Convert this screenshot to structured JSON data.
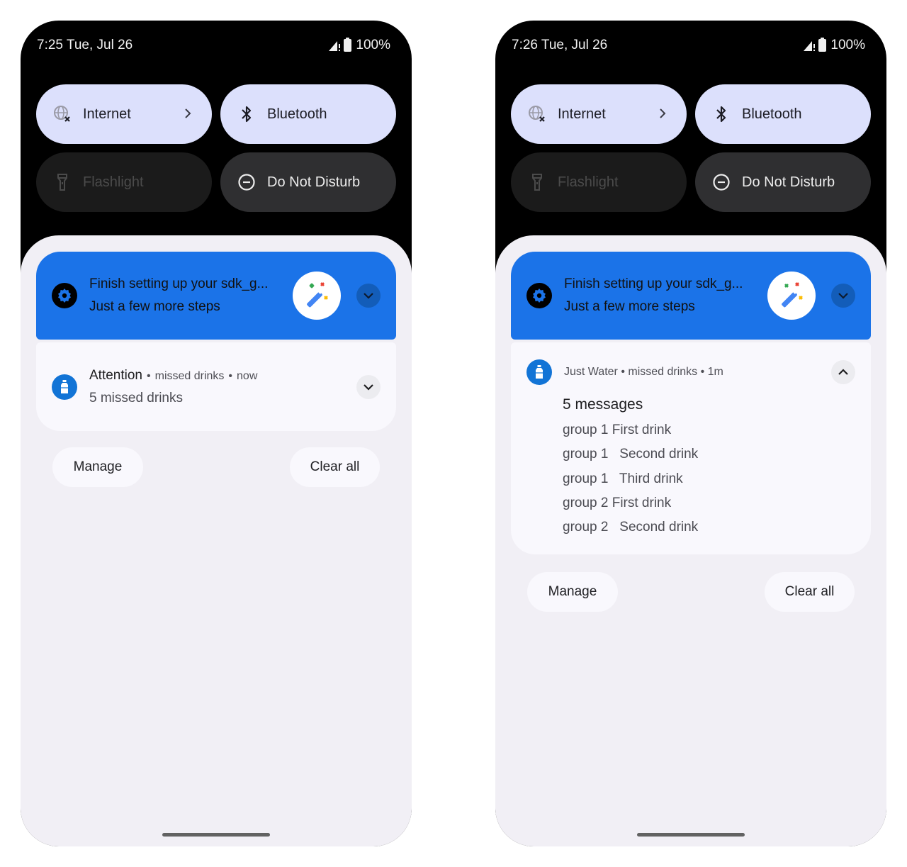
{
  "phones": [
    {
      "status": {
        "time_date": "7:25 Tue, Jul 26",
        "battery": "100%"
      },
      "tiles": [
        {
          "label": "Internet",
          "icon": "globe-no-connection-icon",
          "state": "on",
          "has_chevron": true
        },
        {
          "label": "Bluetooth",
          "icon": "bluetooth-icon",
          "state": "on"
        },
        {
          "label": "Flashlight",
          "icon": "flashlight-icon",
          "state": "unavailable"
        },
        {
          "label": "Do Not Disturb",
          "icon": "do-not-disturb-icon",
          "state": "off"
        }
      ],
      "setup_notification": {
        "title": "Finish setting up your sdk_g...",
        "subtitle": "Just a few more steps"
      },
      "drinks_notification": {
        "expanded": false,
        "app_title": "Attention",
        "channel": "missed drinks",
        "time": "now",
        "body": "5 missed drinks"
      },
      "actions": {
        "manage": "Manage",
        "clear_all": "Clear all"
      }
    },
    {
      "status": {
        "time_date": "7:26 Tue, Jul 26",
        "battery": "100%"
      },
      "tiles": [
        {
          "label": "Internet",
          "icon": "globe-no-connection-icon",
          "state": "on",
          "has_chevron": true
        },
        {
          "label": "Bluetooth",
          "icon": "bluetooth-icon",
          "state": "on"
        },
        {
          "label": "Flashlight",
          "icon": "flashlight-icon",
          "state": "unavailable"
        },
        {
          "label": "Do Not Disturb",
          "icon": "do-not-disturb-icon",
          "state": "off"
        }
      ],
      "setup_notification": {
        "title": "Finish setting up your sdk_g...",
        "subtitle": "Just a few more steps"
      },
      "drinks_notification": {
        "expanded": true,
        "header": "Just Water • missed drinks • 1m",
        "title": "5 messages",
        "lines": [
          "group 1 First drink",
          "group 1   Second drink",
          "group 1   Third drink",
          "group 2 First drink",
          "group 2   Second drink"
        ]
      },
      "actions": {
        "manage": "Manage",
        "clear_all": "Clear all"
      }
    }
  ],
  "colors": {
    "tile_on": "#dce0fc",
    "setup_blue": "#1b73e8",
    "shade_bg": "#f1eff5",
    "app_icon_blue": "#1274d6"
  }
}
